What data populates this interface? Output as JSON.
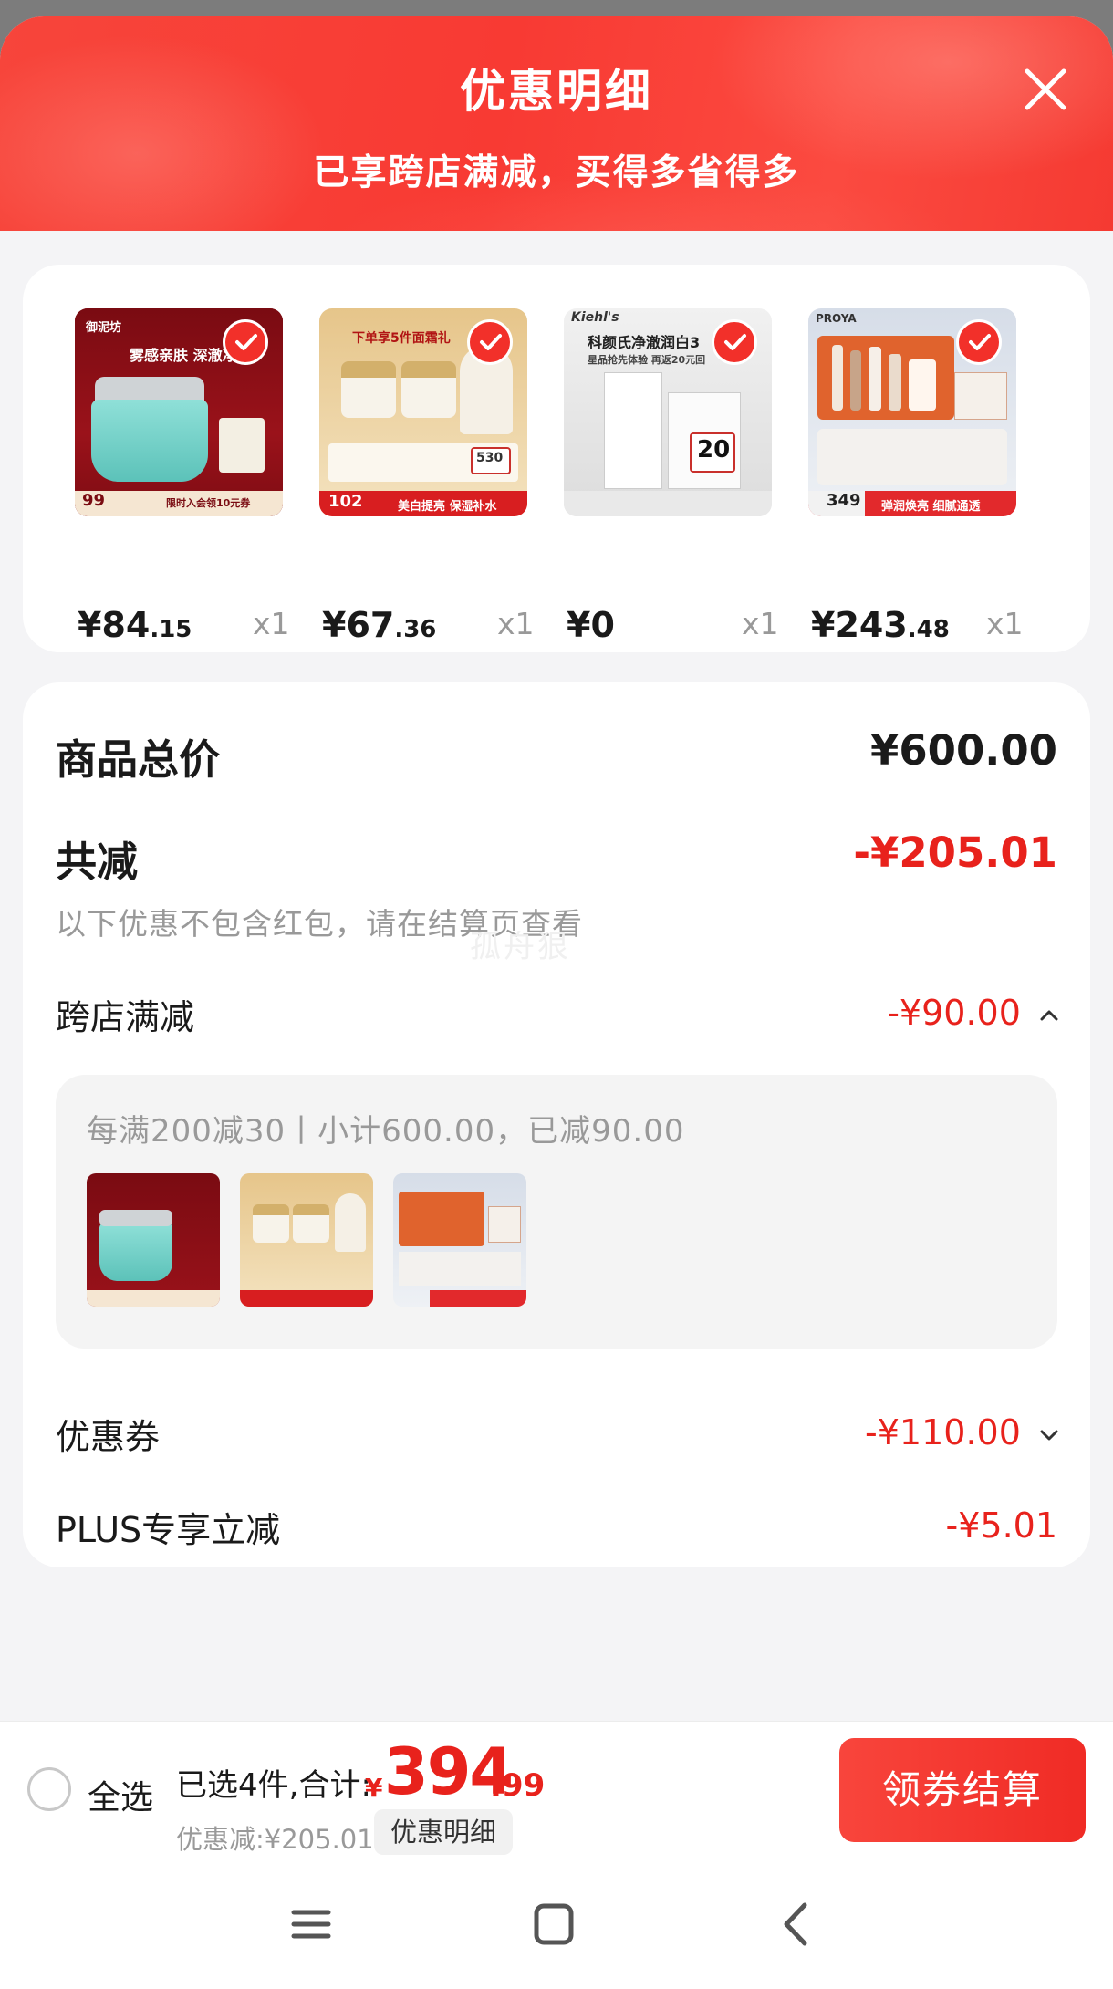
{
  "header": {
    "title": "优惠明细",
    "subtitle": "已享跨店满减，买得多省得多"
  },
  "products": [
    {
      "price_int": "¥84",
      "price_dec": ".15",
      "qty": "x1",
      "thumb": "mud-mask-product",
      "badge": "99",
      "banner": "限时入会领10元券",
      "brand": "御泥坊",
      "slogan": "雾感亲肤 深澈净"
    },
    {
      "price_int": "¥67",
      "price_dec": ".36",
      "qty": "x1",
      "thumb": "cream-jars-product",
      "badge": "102",
      "banner": "美白提亮 保湿补水",
      "headline": "下单享5件面霜礼",
      "promo_num": "530"
    },
    {
      "price_int": "¥0",
      "price_dec": "",
      "qty": "x1",
      "thumb": "kiehls-sample-product",
      "brand": "Kiehl's",
      "headline": "科颜氏净澈润白3",
      "line2": "星品抢先体验 再返20元回",
      "promo_num": "20"
    },
    {
      "price_int": "¥243",
      "price_dec": ".48",
      "qty": "x1",
      "thumb": "proya-set-product",
      "brand": "PROYA",
      "badge": "349",
      "banner": "弹润焕亮 细腻通透"
    }
  ],
  "summary": {
    "total_label": "商品总价",
    "total_value": "¥600.00",
    "reduce_label": "共减",
    "reduce_value": "-¥205.01",
    "note": "以下优惠不包含红包，请在结算页查看",
    "watermark": "孤舟狠",
    "cross_store_label": "跨店满减",
    "cross_store_value": "-¥90.00",
    "cross_store_detail": "每满200减30丨小计600.00，已减90.00",
    "coupon_label": "优惠券",
    "coupon_value": "-¥110.00",
    "plus_label": "PLUS专享立减",
    "plus_value": "-¥5.01"
  },
  "bottom": {
    "select_all": "全选",
    "selected_text": "已选4件,合计:",
    "total_sign": "¥",
    "total_int": "394",
    "total_dec": ".99",
    "saving": "优惠减:¥205.01",
    "detail_button": "优惠明细",
    "checkout_button": "领券结算"
  },
  "nav": [
    "menu-icon",
    "home-square-icon",
    "back-chevron-icon"
  ],
  "colors": {
    "accent": "#e8221c",
    "header": "#f83a33"
  }
}
